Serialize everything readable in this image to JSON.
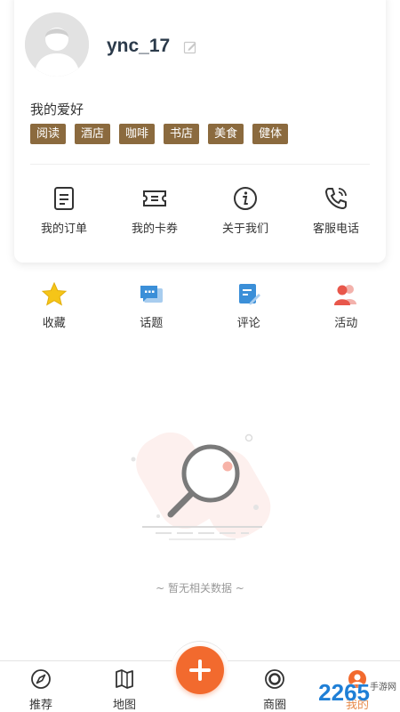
{
  "profile": {
    "username": "ync_17",
    "hobby_title": "我的爱好",
    "hobbies": [
      "阅读",
      "酒店",
      "咖啡",
      "书店",
      "美食",
      "健体"
    ]
  },
  "menu": [
    {
      "label": "我的订单",
      "icon": "order-list-icon"
    },
    {
      "label": "我的卡券",
      "icon": "ticket-icon"
    },
    {
      "label": "关于我们",
      "icon": "info-icon"
    },
    {
      "label": "客服电话",
      "icon": "phone-icon"
    }
  ],
  "quick_actions": [
    {
      "label": "收藏",
      "icon": "star-icon",
      "color": "#f5c518"
    },
    {
      "label": "话题",
      "icon": "chat-icon",
      "color": "#3b8fd8"
    },
    {
      "label": "评论",
      "icon": "comment-edit-icon",
      "color": "#3b8fd8"
    },
    {
      "label": "活动",
      "icon": "people-icon",
      "color": "#e8574b"
    }
  ],
  "empty_state": {
    "text": "~ 暂无相关数据 ~"
  },
  "bottom_nav": [
    {
      "label": "推荐",
      "icon": "compass-icon"
    },
    {
      "label": "地图",
      "icon": "map-icon"
    },
    {
      "label": "商圈",
      "icon": "circle-icon"
    },
    {
      "label": "我的",
      "icon": "profile-icon",
      "active": true
    }
  ],
  "colors": {
    "tag_bg": "#8b6a3e",
    "accent": "#f26a2e",
    "active_tab": "#e78a4a"
  },
  "watermark": {
    "main": "2265",
    "sub": "手游网"
  }
}
